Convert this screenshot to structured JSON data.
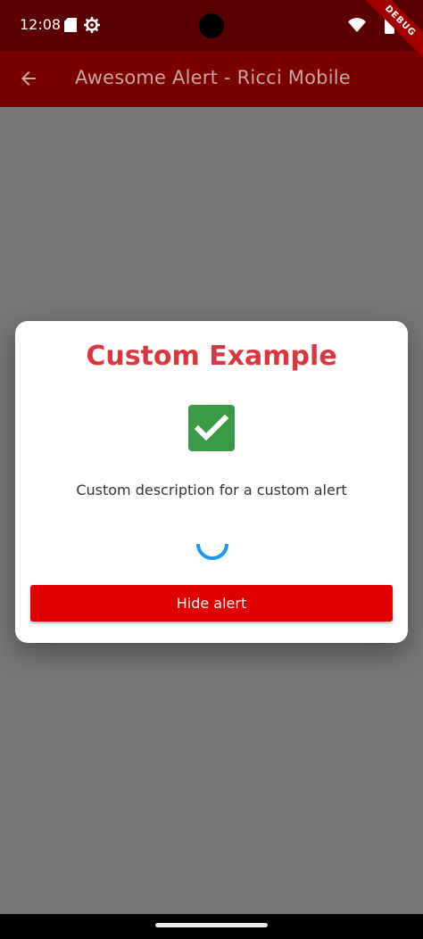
{
  "status_bar": {
    "time": "12:08",
    "icons": [
      "sd-card-icon",
      "gear-icon",
      "wifi-icon",
      "battery-icon"
    ]
  },
  "app_bar": {
    "title": "Awesome Alert - Ricci Mobile",
    "back_icon": "arrow-left-icon"
  },
  "debug_banner": {
    "label": "DEBUG"
  },
  "dialog": {
    "title": "Custom Example",
    "icon": "check-square-icon",
    "description": "Custom description for a custom alert",
    "button_label": "Hide alert"
  },
  "colors": {
    "status_bar": "#5b0000",
    "app_bar": "#7a0000",
    "title_red": "#d9363e",
    "button_red": "#e00000",
    "check_green": "#3a9a44",
    "spinner_blue": "#2196f3",
    "scrim": "#767676"
  }
}
